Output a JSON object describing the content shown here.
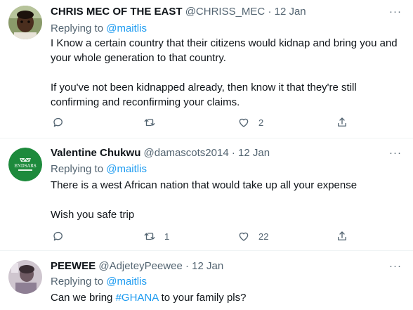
{
  "tweets": [
    {
      "name": "CHRIS MEC OF THE EAST",
      "handle": "@CHRISS_MEC",
      "separator": "·",
      "date": "12 Jan",
      "replying_prefix": "Replying to",
      "replying_to": "@maitlis",
      "text": "I Know a certain country that their citizens would kidnap and bring you and\nyour whole generation to that country.\n\nIf you've not been kidnapped already, then know it that they're still\nconfirming and reconfirming your claims.",
      "reply_count": "",
      "retweet_count": "",
      "like_count": "2",
      "avatar_icon": "child-photo-avatar"
    },
    {
      "name": "Valentine Chukwu",
      "handle": "@damascots2014",
      "separator": "·",
      "date": "12 Jan",
      "replying_prefix": "Replying to",
      "replying_to": "@maitlis",
      "text": "There is a west African nation that would take up all your expense\n\nWish you safe trip",
      "reply_count": "",
      "retweet_count": "1",
      "like_count": "22",
      "avatar_icon": "endsars-logo-avatar",
      "avatar_label": "ENDSARS"
    },
    {
      "name": "PEEWEE",
      "handle": "@AdjeteyPeewee",
      "separator": "·",
      "date": "12 Jan",
      "replying_prefix": "Replying to",
      "replying_to": "@maitlis",
      "text_before": "Can we bring ",
      "hashtag": "#GHANA",
      "text_after": " to your family pls?",
      "avatar_icon": "photo-avatar"
    }
  ],
  "more_label": "···",
  "colors": {
    "link": "#1d9bf0",
    "secondary": "#536471",
    "divider": "#eff3f4"
  }
}
